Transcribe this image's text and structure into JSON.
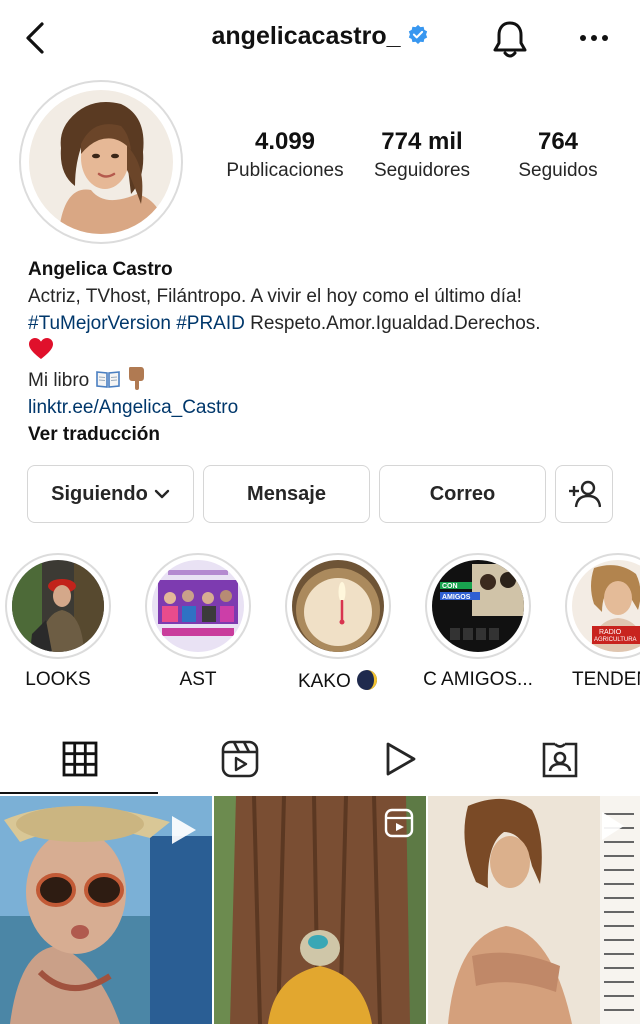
{
  "header": {
    "username": "angelicacastro_",
    "icons": {
      "back": "chevron-left-icon",
      "verified": "verified-badge-icon",
      "notifications": "bell-icon",
      "more": "more-horizontal-icon"
    }
  },
  "profile": {
    "stats": [
      {
        "value": "4.099",
        "label": "Publicaciones"
      },
      {
        "value": "774 mil",
        "label": "Seguidores"
      },
      {
        "value": "764",
        "label": "Seguidos"
      }
    ]
  },
  "bio": {
    "name": "Angelica Castro",
    "line1": "Actriz, TVhost, Filántropo. A vivir el hoy como el último día!",
    "hashtag1": "#TuMejorVersion",
    "hashtag2": "#PRAID",
    "line2_rest": " Respeto.Amor.Igualdad.Derechos.",
    "book_label": "Mi libro",
    "link": "linktr.ee/Angelica_Castro",
    "translate": "Ver traducción"
  },
  "actions": {
    "following": "Siguiendo",
    "message": "Mensaje",
    "email": "Correo"
  },
  "highlights": [
    {
      "label": "LOOKS"
    },
    {
      "label": "AST"
    },
    {
      "label": "KAKO"
    },
    {
      "label": "C AMIGOS..."
    },
    {
      "label": "TENDENC"
    }
  ],
  "highlight_text": {
    "con": "CON",
    "amigos": "AMIGOS",
    "radio": "RADIO",
    "agricultura": "AGRICULTURA"
  },
  "tabs": [
    {
      "name": "grid-icon",
      "active": true
    },
    {
      "name": "reels-icon"
    },
    {
      "name": "video-play-icon"
    },
    {
      "name": "tagged-icon"
    }
  ],
  "colors": {
    "link": "#00376b",
    "verified": "#3897f0",
    "text": "#262626",
    "border": "#dbdbdb"
  }
}
